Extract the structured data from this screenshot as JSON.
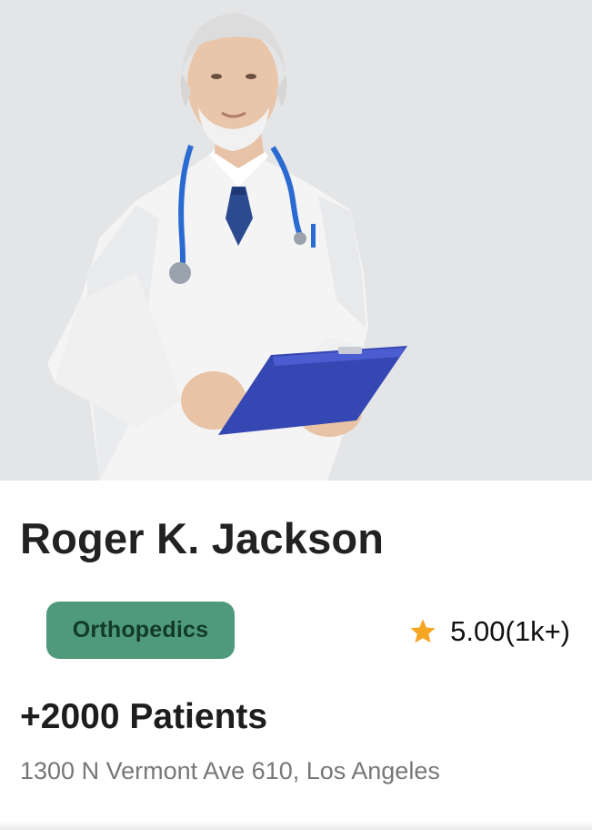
{
  "doctor": {
    "name": "Roger K. Jackson",
    "specialty": "Orthopedics",
    "rating": "5.00(1k+)",
    "patients": "+2000 Patients",
    "address": "1300 N Vermont Ave 610, Los Angeles"
  },
  "icons": {
    "rating": "star-icon"
  },
  "colors": {
    "badge_bg": "#4f9a7c",
    "badge_text": "#123a2a",
    "star": "#f5a623",
    "name_text": "#222222",
    "address_text": "#777777"
  }
}
